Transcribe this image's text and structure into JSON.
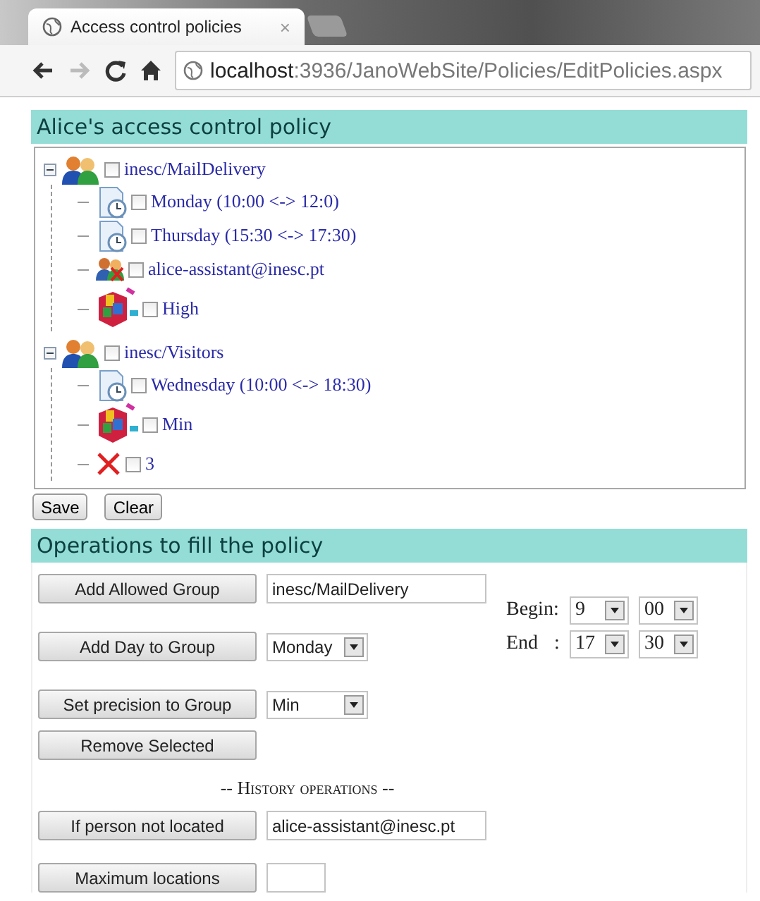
{
  "browser": {
    "tab_title": "Access control policies",
    "tab_close": "×",
    "url_host": "localhost",
    "url_path": ":3936/JanoWebSite/Policies/EditPolicies.aspx"
  },
  "policy": {
    "title": "Alice's access control policy",
    "tree": [
      {
        "kind": "group",
        "label": "inesc/MailDelivery",
        "checked": false,
        "expanded": true,
        "children": [
          {
            "kind": "day",
            "label": "Monday (10:00 <-> 12:0)",
            "checked": false
          },
          {
            "kind": "day",
            "label": "Thursday (15:30 <-> 17:30)",
            "checked": false
          },
          {
            "kind": "person",
            "label": "alice-assistant@inesc.pt",
            "checked": false
          },
          {
            "kind": "precision",
            "label": "High",
            "checked": false
          }
        ]
      },
      {
        "kind": "group",
        "label": "inesc/Visitors",
        "checked": false,
        "expanded": true,
        "children": [
          {
            "kind": "day",
            "label": "Wednesday (10:00 <-> 18:30)",
            "checked": false
          },
          {
            "kind": "precision",
            "label": "Min",
            "checked": false
          },
          {
            "kind": "deny",
            "label": "3",
            "checked": false
          }
        ]
      }
    ]
  },
  "buttons": [
    {
      "label": "Save"
    },
    {
      "label": "Clear"
    }
  ],
  "operations": {
    "title": "Operations to fill the policy",
    "rows": [
      {
        "kind": "input",
        "button": "Add Allowed Group",
        "value": "inesc/MailDelivery"
      },
      {
        "kind": "select",
        "button": "Add Day to Group",
        "value": "Monday"
      },
      {
        "kind": "select",
        "button": "Set precision to Group",
        "value": "Min"
      },
      {
        "kind": "button",
        "button": "Remove Selected"
      },
      {
        "kind": "separator",
        "text": "-- History operations --"
      },
      {
        "kind": "input",
        "button": "If person not located",
        "value": "alice-assistant@inesc.pt"
      },
      {
        "kind": "input",
        "button": "Maximum locations"
      }
    ],
    "time": {
      "begin_label": "Begin:",
      "begin_hour": "9",
      "begin_minute": "00",
      "end_label": "End :",
      "end_hour": "17",
      "end_minute": "30"
    }
  }
}
